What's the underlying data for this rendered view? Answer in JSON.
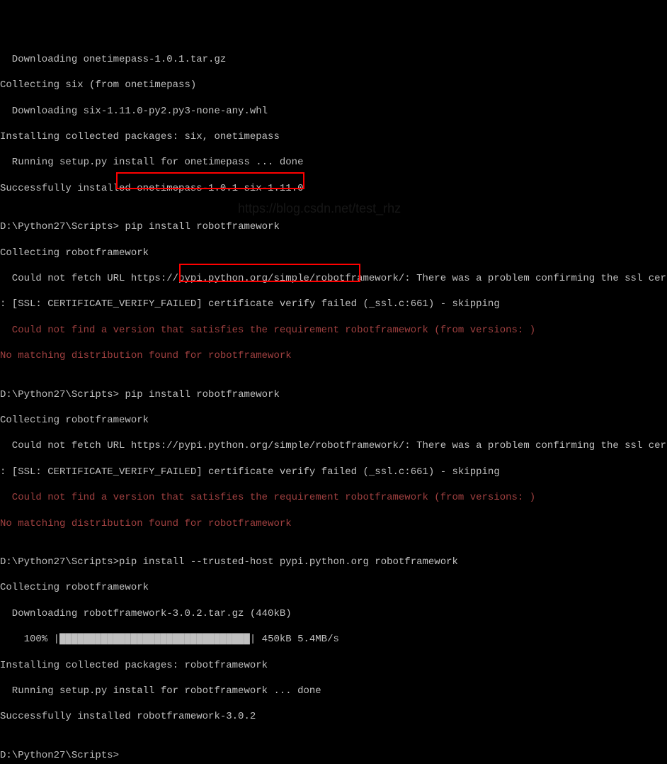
{
  "watermark": "https://blog.csdn.net/test_rhz",
  "lines": {
    "l01": "  Downloading onetimepass-1.0.1.tar.gz",
    "l02": "Collecting six (from onetimepass)",
    "l03": "  Downloading six-1.11.0-py2.py3-none-any.whl",
    "l04": "Installing collected packages: six, onetimepass",
    "l05": "  Running setup.py install for onetimepass ... done",
    "l06": "Successfully installed onetimepass-1.0.1 six-1.11.0",
    "l07": "",
    "p1_prompt": "D:\\Python27\\Scripts> ",
    "p1_cmd": "pip install robotframework",
    "l09": "Collecting robotframework",
    "l10": "  Could not fetch URL https://pypi.python.org/simple/robotframework/: There was a problem confirming the ssl certifica",
    "l11": ": [SSL: CERTIFICATE_VERIFY_FAILED] certificate verify failed (_ssl.c:661) - skipping",
    "l12": "  Could not find a version that satisfies the requirement robotframework (from versions: )",
    "l13": "No matching distribution found for robotframework",
    "l14": "",
    "p2_prompt": "D:\\Python27\\Scripts> ",
    "p2_cmd": "pip install robotframework",
    "l16": "Collecting robotframework",
    "l17": "  Could not fetch URL https://pypi.python.org/simple/robotframework/: There was a problem confirming the ssl certifica",
    "l18": ": [SSL: CERTIFICATE_VERIFY_FAILED] certificate verify failed (_ssl.c:661) - skipping",
    "l19": "  Could not find a version that satisfies the requirement robotframework (from versions: )",
    "l20": "No matching distribution found for robotframework",
    "l21": "",
    "p3_prompt": "D:\\Python27\\Scripts>",
    "p3_cmd": "pip install --trusted-host pypi.python.org robotframework",
    "l23": "Collecting robotframework",
    "l24": "  Downloading robotframework-3.0.2.tar.gz (440kB)",
    "l25a": "    100% |",
    "l25b": "████████████████████████████████",
    "l25c": "| 450kB 5.4MB/s",
    "l26": "Installing collected packages: robotframework",
    "l27": "  Running setup.py install for robotframework ... done",
    "l28": "Successfully installed robotframework-3.0.2",
    "l29": "",
    "p4_prompt": "D:\\Python27\\Scripts>"
  }
}
